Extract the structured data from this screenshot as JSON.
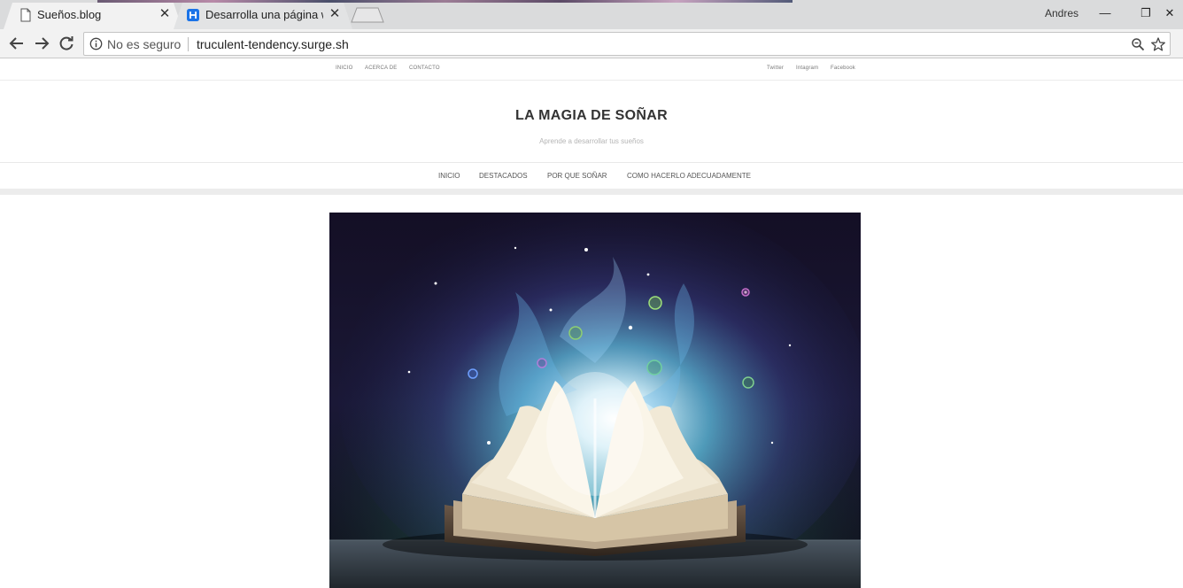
{
  "browser": {
    "tabs": [
      {
        "title": "Sueños.blog",
        "active": true,
        "favicon": "page-icon"
      },
      {
        "title": "Desarrolla una página we",
        "active": false,
        "favicon": "h-logo-icon"
      }
    ],
    "user": "Andres",
    "window_controls": {
      "minimize": "—",
      "restore": "❐",
      "close": "✕"
    },
    "security_label": "No es seguro",
    "url": "truculent-tendency.surge.sh",
    "colors": {
      "favicon_blue": "#1a73e8"
    }
  },
  "site": {
    "topbar_left": [
      "Inicio",
      "Acerca de",
      "Contacto"
    ],
    "topbar_right": [
      "Twitter",
      "Intagram",
      "Facebook"
    ],
    "title": "LA MAGIA DE SOÑAR",
    "tagline": "Aprende a desarrollar tus sueños",
    "nav": [
      "Inicio",
      "Destacados",
      "Por que soñar",
      "Como hacerlo adecuadamente"
    ]
  }
}
